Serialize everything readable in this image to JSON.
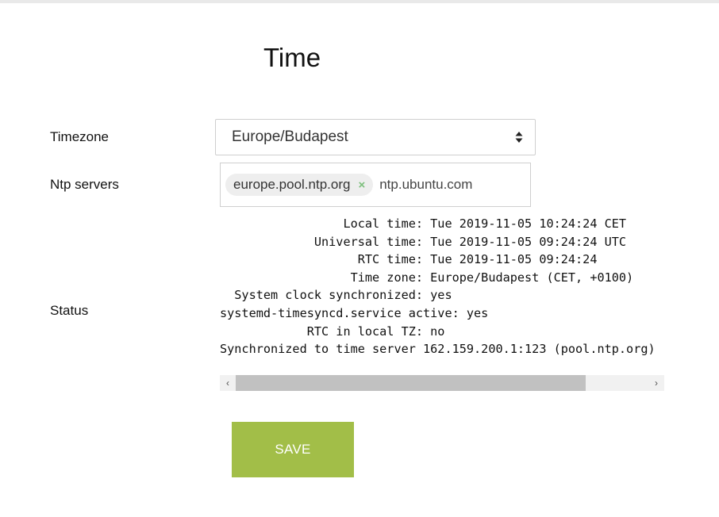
{
  "page": {
    "title": "Time"
  },
  "timezone": {
    "label": "Timezone",
    "value": "Europe/Budapest"
  },
  "ntp": {
    "label": "Ntp servers",
    "tags": [
      {
        "label": "europe.pool.ntp.org",
        "remove_glyph": "×"
      }
    ],
    "input_value": "ntp.ubuntu.com"
  },
  "status": {
    "label": "Status",
    "output": "                 Local time: Tue 2019-11-05 10:24:24 CET\n             Universal time: Tue 2019-11-05 09:24:24 UTC\n                   RTC time: Tue 2019-11-05 09:24:24\n                  Time zone: Europe/Budapest (CET, +0100)\n  System clock synchronized: yes\nsystemd-timesyncd.service active: yes\n            RTC in local TZ: no\nSynchronized to time server 162.159.200.1:123 (pool.ntp.org)"
  },
  "scrollbar": {
    "left_glyph": "‹",
    "right_glyph": "›",
    "thumb_fraction": 0.79
  },
  "save": {
    "label": "SAVE"
  },
  "colors": {
    "accent": "#a2be48",
    "tag_remove": "#7cbf7c"
  }
}
